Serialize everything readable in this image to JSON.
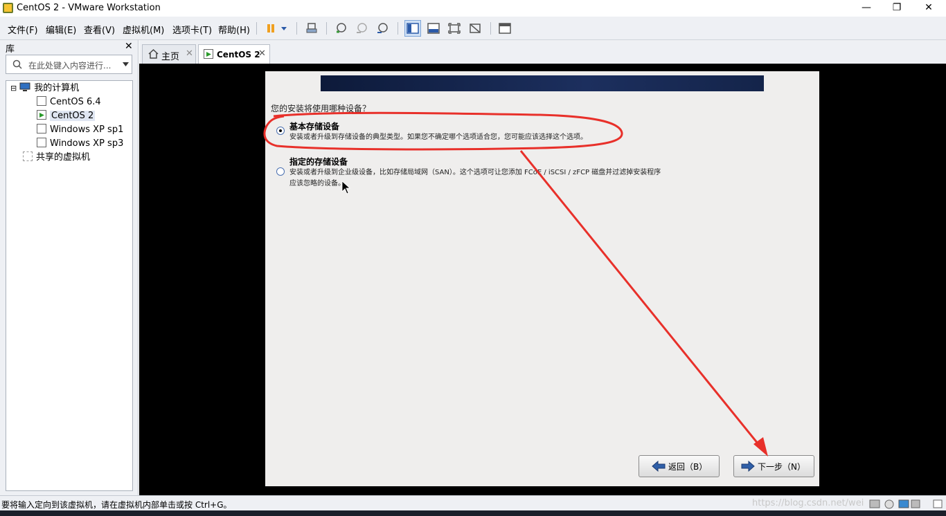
{
  "window": {
    "title": "CentOS 2 - VMware Workstation",
    "controls": {
      "minimize": "—",
      "restore": "❐",
      "close": "✕"
    }
  },
  "menu": [
    "文件(F)",
    "编辑(E)",
    "查看(V)",
    "虚拟机(M)",
    "选项卡(T)",
    "帮助(H)"
  ],
  "toolbar": {
    "icons": [
      "pause-icon",
      "dropdown-arrow-icon",
      "send-ctrl-alt-del-icon",
      "snapshot-take-icon",
      "snapshot-revert-icon",
      "snapshot-manager-icon",
      "library-view-icon",
      "console-view-icon",
      "fullscreen-icon",
      "unity-icon",
      "thumbnail-view-icon"
    ]
  },
  "sidebar": {
    "header": "库",
    "close": "✕",
    "search_placeholder": "在此处键入内容进行...",
    "tree": [
      {
        "label": "我的计算机",
        "level": 0,
        "icon": "computer-icon",
        "expander": "⊟"
      },
      {
        "label": "CentOS 6.4",
        "level": 1,
        "icon": "vm-icon"
      },
      {
        "label": "CentOS 2",
        "level": 1,
        "icon": "vm-running-icon",
        "selected": true
      },
      {
        "label": "Windows XP sp1",
        "level": 1,
        "icon": "vm-icon"
      },
      {
        "label": "Windows XP sp3",
        "level": 1,
        "icon": "vm-icon"
      },
      {
        "label": "共享的虚拟机",
        "level": 0,
        "icon": "shared-vms-icon"
      }
    ]
  },
  "tabs": [
    {
      "label": "主页",
      "icon": "home-icon",
      "close": "✕",
      "active": false
    },
    {
      "label": "CentOS 2",
      "icon": "vm-running-icon",
      "close": "✕",
      "active": true
    }
  ],
  "installer": {
    "question": "您的安装将使用哪种设备？",
    "options": [
      {
        "title": "基本存储设备",
        "desc": [
          "安装或者升级到存储设备的典型类型。如果您不确定哪个选项适合您，您可能应该选择这个选项。"
        ],
        "selected": true
      },
      {
        "title": "指定的存储设备",
        "desc": [
          "安装或者升级到企业级设备，比如存储局域网（SAN）。这个选项可让您添加 FCoE / iSCSI / zFCP 磁盘并过滤掉安装程序",
          "应该忽略的设备。"
        ],
        "selected": false
      }
    ],
    "back_button": "返回（B）",
    "next_button": "下一步（N）"
  },
  "annotation": {
    "color": "#e8302a"
  },
  "statusbar": {
    "message": "要将输入定向到该虚拟机，请在虚拟机内部单击或按 Ctrl+G。",
    "watermark": "https://blog.csdn.net/wei"
  }
}
